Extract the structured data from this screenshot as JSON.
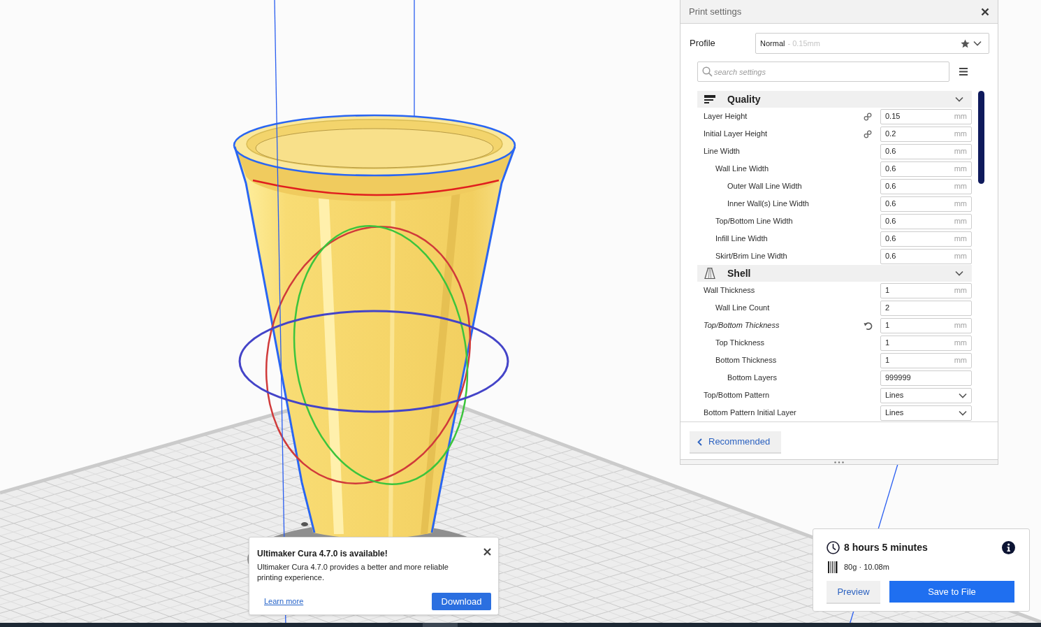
{
  "print_settings": {
    "title": "Print settings",
    "profile": {
      "label": "Profile",
      "value": "Normal",
      "detail": "- 0.15mm"
    },
    "search": {
      "placeholder": "search settings"
    },
    "categories": [
      {
        "title": "Quality",
        "kind": "quality",
        "expanded": true,
        "settings": [
          {
            "label": "Layer Height",
            "kind": "number",
            "value": "0.15",
            "unit": "mm",
            "linked": true,
            "modified": false
          },
          {
            "label": "Initial Layer Height",
            "kind": "number",
            "value": "0.2",
            "unit": "mm",
            "linked": true,
            "modified": false
          },
          {
            "label": "Line Width",
            "kind": "number",
            "value": "0.6",
            "unit": "mm",
            "linked": false,
            "modified": false,
            "children": [
              {
                "label": "Wall Line Width",
                "kind": "number",
                "value": "0.6",
                "unit": "mm",
                "linked": false,
                "modified": false,
                "children": [
                  {
                    "label": "Outer Wall Line Width",
                    "kind": "number",
                    "value": "0.6",
                    "unit": "mm",
                    "linked": false,
                    "modified": false
                  },
                  {
                    "label": "Inner Wall(s) Line Width",
                    "kind": "number",
                    "value": "0.6",
                    "unit": "mm",
                    "linked": false,
                    "modified": false
                  }
                ]
              },
              {
                "label": "Top/Bottom Line Width",
                "kind": "number",
                "value": "0.6",
                "unit": "mm",
                "linked": false,
                "modified": false
              },
              {
                "label": "Infill Line Width",
                "kind": "number",
                "value": "0.6",
                "unit": "mm",
                "linked": false,
                "modified": false
              },
              {
                "label": "Skirt/Brim Line Width",
                "kind": "number",
                "value": "0.6",
                "unit": "mm",
                "linked": false,
                "modified": false
              }
            ]
          }
        ]
      },
      {
        "title": "Shell",
        "kind": "shell",
        "expanded": true,
        "settings": [
          {
            "label": "Wall Thickness",
            "kind": "number",
            "value": "1",
            "unit": "mm",
            "linked": false,
            "modified": false,
            "children": [
              {
                "label": "Wall Line Count",
                "kind": "number",
                "value": "2",
                "linked": false,
                "modified": false
              }
            ]
          },
          {
            "label": "Top/Bottom Thickness",
            "kind": "number",
            "value": "1",
            "unit": "mm",
            "linked": false,
            "modified": true,
            "children": [
              {
                "label": "Top Thickness",
                "kind": "number",
                "value": "1",
                "unit": "mm",
                "linked": false,
                "modified": false
              },
              {
                "label": "Bottom Thickness",
                "kind": "number",
                "value": "1",
                "unit": "mm",
                "linked": false,
                "modified": false,
                "children": [
                  {
                    "label": "Bottom Layers",
                    "kind": "number",
                    "value": "999999",
                    "linked": false,
                    "modified": false
                  }
                ]
              }
            ]
          },
          {
            "label": "Top/Bottom Pattern",
            "kind": "dropdown",
            "value": "Lines",
            "linked": false,
            "modified": false
          },
          {
            "label": "Bottom Pattern Initial Layer",
            "kind": "dropdown",
            "value": "Lines",
            "linked": false,
            "modified": false
          }
        ]
      }
    ],
    "footer": {
      "button": "Recommended"
    }
  },
  "notification": {
    "title": "Ultimaker Cura 4.7.0 is available!",
    "message": "Ultimaker Cura 4.7.0 provides a better and more reliable printing experience.",
    "link": "Learn more",
    "button": "Download"
  },
  "print_info": {
    "time": "8 hours 5 minutes",
    "material": "80g · 10.08m",
    "buttons": [
      {
        "label": "Preview",
        "kind": "secondary"
      },
      {
        "label": "Save to File",
        "kind": "primary"
      }
    ]
  }
}
